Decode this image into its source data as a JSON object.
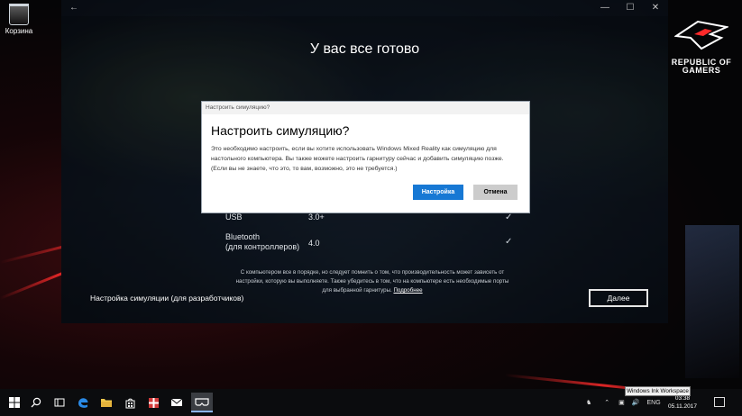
{
  "desktop": {
    "recycle_bin_label": "Корзина",
    "brand_line1": "REPUBLIC OF",
    "brand_line2": "GAMERS",
    "accent_color": "#ff2a2a"
  },
  "window": {
    "back_icon": "←",
    "minimize_icon": "—",
    "maximize_icon": "☐",
    "close_icon": "✕",
    "title": "У вас все готово",
    "requirements": [
      {
        "name": "USB",
        "value": "3.0+",
        "check": "✓"
      },
      {
        "name": "Bluetooth\n(для контроллеров)",
        "value": "4.0",
        "check": "✓"
      }
    ],
    "note_text": "С компьютером все в порядке, но следует помнить о том, что производительность может зависеть от настройки, которую вы выполняете. Также убедитесь в том, что на компьютере есть необходимые порты для выбранной гарнитуры.",
    "note_link": "Подробнее",
    "dev_setup_link": "Настройка симуляции (для разработчиков)",
    "next_button": "Далее"
  },
  "dialog": {
    "caption": "Настроить симуляцию?",
    "heading": "Настроить симуляцию?",
    "body": "Это необходимо настроить, если вы хотите использовать Windows Mixed Reality как симуляцию для настольного компьютера. Вы также можете настроить гарнитуру сейчас и добавить симуляцию позже. (Если вы не знаете, что это, то вам, возможно, это не требуется.)",
    "primary_button": "Настройка",
    "secondary_button": "Отмена",
    "primary_color": "#1778d4"
  },
  "taskbar": {
    "tray_language": "ENG",
    "clock_time": "03:38",
    "clock_date": "05.11.2017",
    "tooltip": "Windows Ink Workspace"
  }
}
